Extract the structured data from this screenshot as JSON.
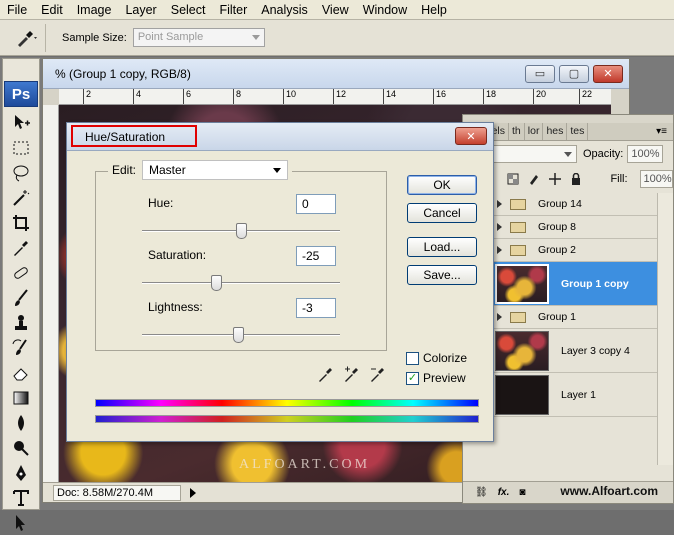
{
  "menu": [
    "File",
    "Edit",
    "Image",
    "Layer",
    "Select",
    "Filter",
    "Analysis",
    "View",
    "Window",
    "Help"
  ],
  "options": {
    "sample_size_label": "Sample Size:",
    "sample_size_value": "Point Sample"
  },
  "document": {
    "title": "% (Group 1 copy, RGB/8)",
    "ruler_ticks": [
      "2",
      "4",
      "6",
      "8",
      "10",
      "12",
      "14",
      "16",
      "18",
      "20",
      "22"
    ],
    "watermark": "ALFOART.COM",
    "status_doc": "Doc: 8.58M/270.4M",
    "window_buttons": {
      "minimize": "▭",
      "maximize": "▢",
      "close": "✕"
    }
  },
  "toolbox": {
    "logo": "Ps"
  },
  "layers_panel": {
    "tabs": [
      "rs",
      "nels",
      "th",
      "lor",
      "hes",
      "tes"
    ],
    "blend_mode": "al",
    "opacity_label": "Opacity:",
    "opacity_value": "100%",
    "lock_label": "Lock:",
    "fill_label": "Fill:",
    "fill_value": "100%",
    "layers": [
      {
        "name": "Group 14",
        "kind": "group"
      },
      {
        "name": "Group 8",
        "kind": "group"
      },
      {
        "name": "Group 2",
        "kind": "group"
      },
      {
        "name": "Group 1 copy",
        "kind": "image",
        "selected": true
      },
      {
        "name": "Group 1",
        "kind": "group"
      },
      {
        "name": "Layer 3 copy 4",
        "kind": "image"
      },
      {
        "name": "Layer 1",
        "kind": "dark"
      }
    ],
    "bottom_icons": [
      "link-icon",
      "fx-icon",
      "mask-icon"
    ],
    "site_watermark": "www.Alfoart.com"
  },
  "dialog": {
    "title": "Hue/Saturation",
    "edit_label": "Edit:",
    "edit_value": "Master",
    "hue_label": "Hue:",
    "hue_value": "0",
    "saturation_label": "Saturation:",
    "saturation_value": "-25",
    "lightness_label": "Lightness:",
    "lightness_value": "-3",
    "buttons": {
      "ok": "OK",
      "cancel": "Cancel",
      "load": "Load...",
      "save": "Save..."
    },
    "colorize_label": "Colorize",
    "colorize_checked": false,
    "preview_label": "Preview",
    "preview_checked": true
  }
}
